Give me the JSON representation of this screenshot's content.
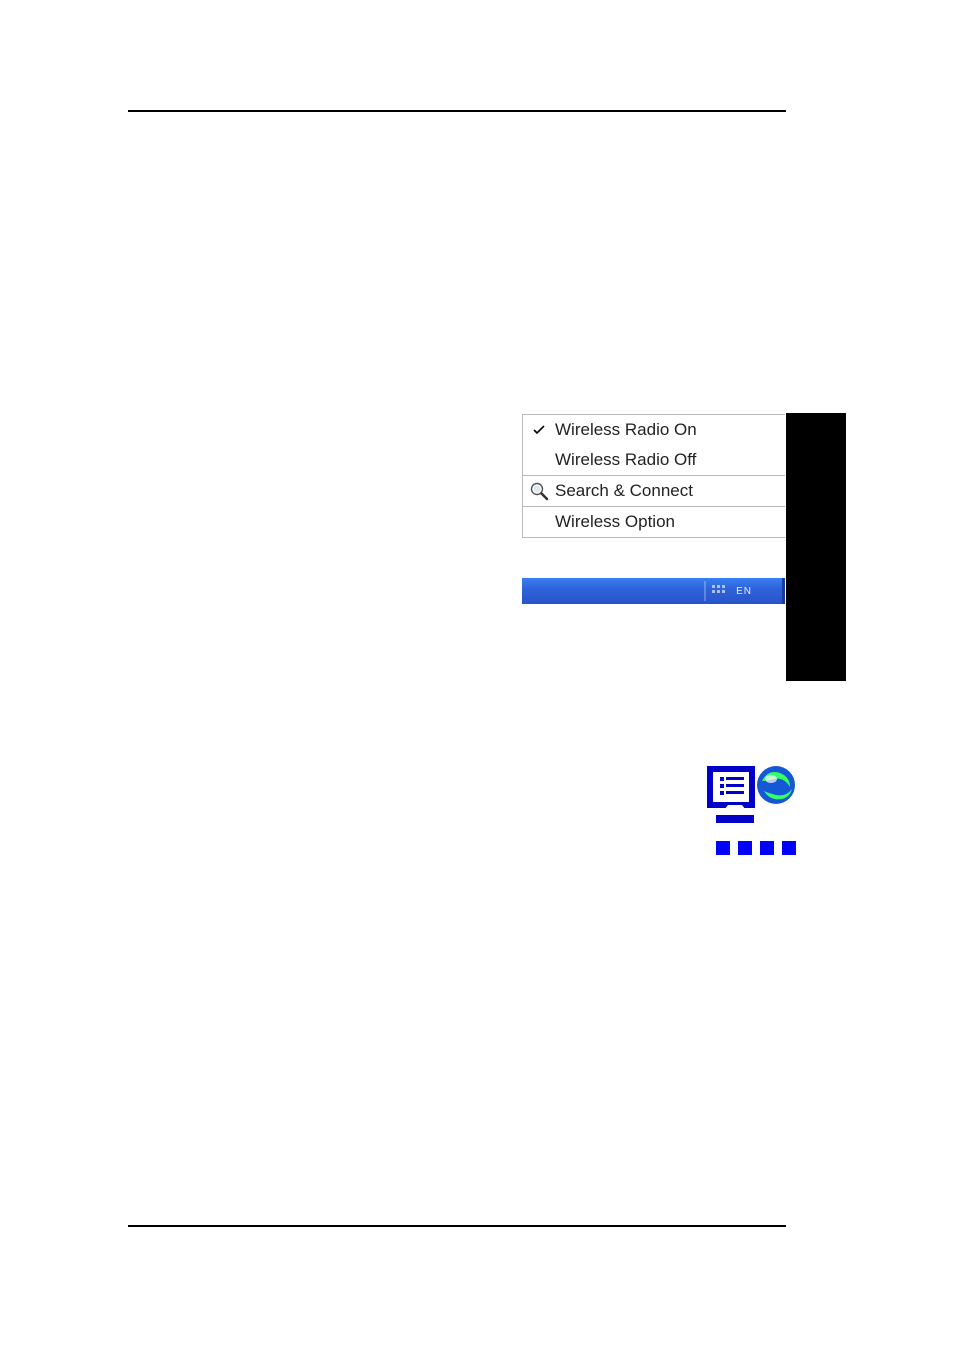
{
  "menu": {
    "radio_on": "Wireless Radio On",
    "radio_off": "Wireless Radio Off",
    "search": "Search & Connect",
    "option": "Wireless Option"
  },
  "taskbar": {
    "lang": "EN"
  },
  "icons": {
    "check": "checkmark-icon",
    "magnifier": "magnifier-icon",
    "network": "network-globe-icon"
  }
}
